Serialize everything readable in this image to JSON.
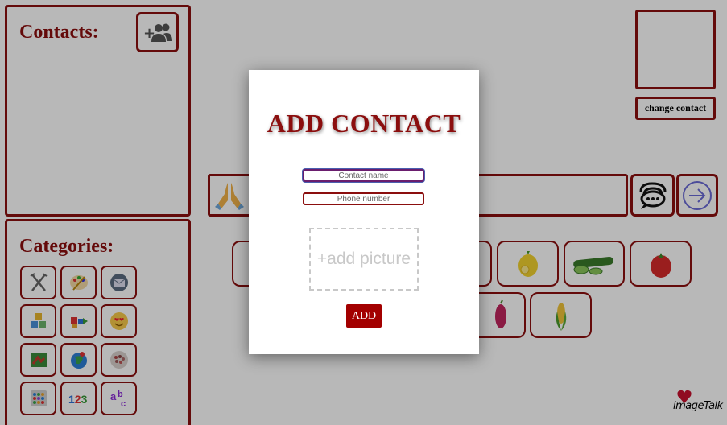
{
  "contacts": {
    "title": "Contacts:"
  },
  "categories": {
    "title": "Categories:",
    "items": [
      {
        "icon": "utensils-icon",
        "label": ""
      },
      {
        "icon": "art-palette-icon",
        "label": ""
      },
      {
        "icon": "mailbox-icon",
        "label": ""
      },
      {
        "icon": "toy-blocks-icon",
        "label": ""
      },
      {
        "icon": "arrows-swap-icon",
        "label": ""
      },
      {
        "icon": "heart-eyes-emoji-icon",
        "label": ""
      },
      {
        "icon": "nature-icon",
        "label": ""
      },
      {
        "icon": "globe-icon",
        "label": ""
      },
      {
        "icon": "crowd-icon",
        "label": ""
      },
      {
        "icon": "calendar-grid-icon",
        "label": ""
      },
      {
        "icon": "numbers-icon",
        "label": "123"
      },
      {
        "icon": "letters-icon",
        "label": "abc"
      }
    ]
  },
  "profile": {
    "change_contact_label": "change contact"
  },
  "modal": {
    "title": "ADD CONTACT",
    "name_placeholder": "Contact name",
    "phone_placeholder": "Phone number",
    "add_picture_label": "+add picture",
    "add_button_label": "ADD"
  },
  "logo": {
    "text": "imageTalk"
  },
  "colors": {
    "accent": "#8b0e0e",
    "button_red": "#a30000",
    "overlay": "rgba(0,0,0,0.28)"
  }
}
